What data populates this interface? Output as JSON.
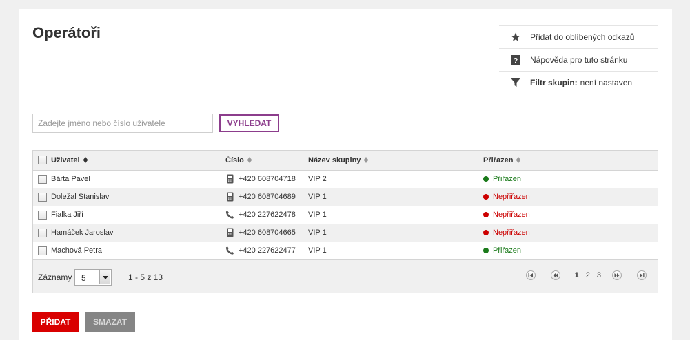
{
  "page": {
    "title": "Operátoři"
  },
  "quick_links": {
    "favorite": {
      "label": "Přidat do oblíbených odkazů",
      "icon": "star-icon"
    },
    "help": {
      "label": "Nápověda pro tuto stránku",
      "icon": "help-icon"
    },
    "filter": {
      "label": "Filtr skupin:",
      "value": "není nastaven",
      "icon": "funnel-icon"
    }
  },
  "search": {
    "placeholder": "Zadejte jméno nebo číslo uživatele",
    "value": "",
    "button_label": "VYHLEDAT"
  },
  "table": {
    "columns": {
      "user": "Uživatel",
      "number": "Číslo",
      "group": "Název skupiny",
      "assigned": "Přiřazen"
    },
    "rows": [
      {
        "user": "Bárta Pavel",
        "number": "+420 608704718",
        "number_type": "mobile-icon",
        "group": "VIP 2",
        "status": "Přiřazen",
        "status_type": "assigned"
      },
      {
        "user": "Doležal Stanislav",
        "number": "+420 608704689",
        "number_type": "mobile-icon",
        "group": "VIP 1",
        "status": "Nepřiřazen",
        "status_type": "unassigned"
      },
      {
        "user": "Fialka Jiří",
        "number": "+420 227622478",
        "number_type": "phone-icon",
        "group": "VIP 1",
        "status": "Nepřiřazen",
        "status_type": "unassigned"
      },
      {
        "user": "Hamáček Jaroslav",
        "number": "+420 608704665",
        "number_type": "mobile-icon",
        "group": "VIP 1",
        "status": "Nepřiřazen",
        "status_type": "unassigned"
      },
      {
        "user": "Machová Petra",
        "number": "+420 227622477",
        "number_type": "phone-icon",
        "group": "VIP 1",
        "status": "Přiřazen",
        "status_type": "assigned"
      }
    ]
  },
  "footer": {
    "records_label": "Záznamy",
    "page_size": "5",
    "range": "1 - 5 z 13",
    "pages": [
      "1",
      "2",
      "3"
    ],
    "current_page": "1"
  },
  "actions": {
    "add_label": "PŘIDAT",
    "delete_label": "SMAZAT"
  },
  "colors": {
    "accent": "#8c3d8c",
    "primary": "#d90000",
    "assigned": "#1a7a1a",
    "unassigned": "#cc0000"
  }
}
